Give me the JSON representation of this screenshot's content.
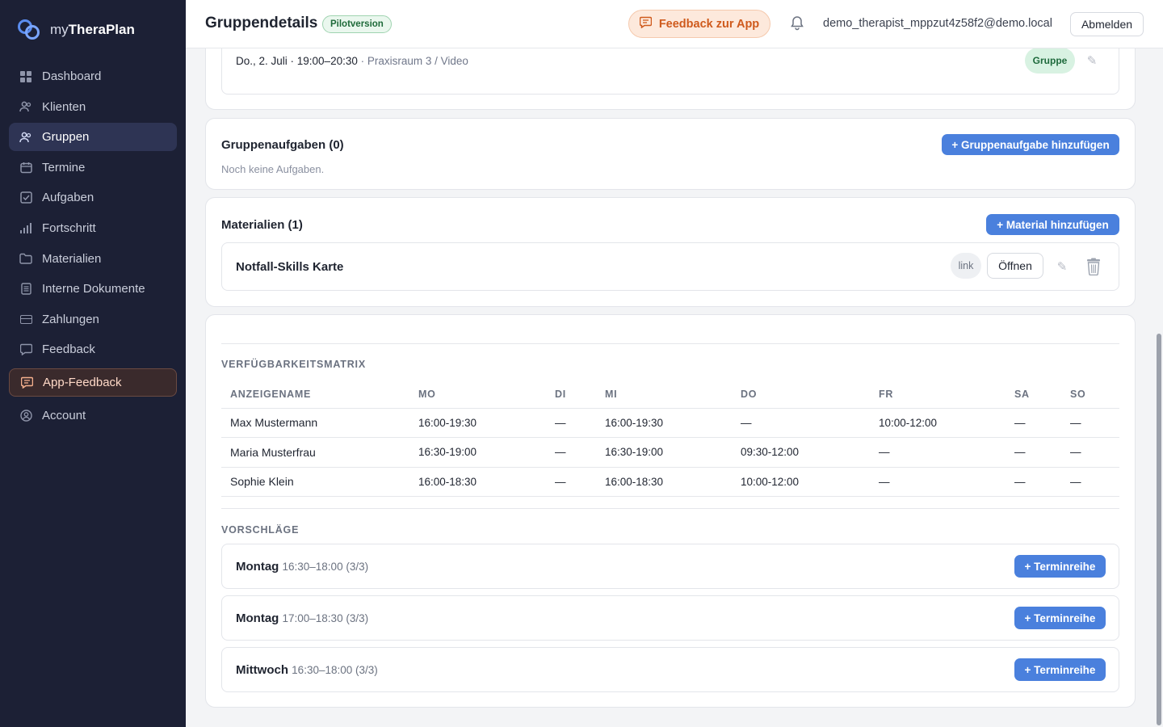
{
  "brand": {
    "prefix": "my",
    "name": "TheraPlan"
  },
  "sidebar": {
    "items": [
      {
        "label": "Dashboard",
        "icon": "grid-icon"
      },
      {
        "label": "Klienten",
        "icon": "users-icon"
      },
      {
        "label": "Gruppen",
        "icon": "group-icon"
      },
      {
        "label": "Termine",
        "icon": "calendar-icon"
      },
      {
        "label": "Aufgaben",
        "icon": "checkbox-icon"
      },
      {
        "label": "Fortschritt",
        "icon": "bar-chart-icon"
      },
      {
        "label": "Materialien",
        "icon": "folder-icon"
      },
      {
        "label": "Interne Dokumente",
        "icon": "document-icon"
      },
      {
        "label": "Zahlungen",
        "icon": "credit-card-icon"
      },
      {
        "label": "Feedback",
        "icon": "chat-bubble-icon"
      },
      {
        "label": "App-Feedback",
        "icon": "message-icon"
      },
      {
        "label": "Account",
        "icon": "user-circle-icon"
      }
    ]
  },
  "header": {
    "title": "Gruppendetails",
    "badge": "Pilotversion",
    "feedback_label": "Feedback zur App",
    "user_email": "demo_therapist_mppzut4z58f2@demo.local",
    "logout_label": "Abmelden"
  },
  "session": {
    "date_time": "Do., 2. Juli · 19:00–20:30",
    "location": "· Praxisraum 3 / Video",
    "type_label": "Gruppe"
  },
  "tasks": {
    "title": "Gruppenaufgaben (0)",
    "add_label": "+ Gruppenaufgabe hinzufügen",
    "empty_text": "Noch keine Aufgaben."
  },
  "materials": {
    "title": "Materialien (1)",
    "add_label": "+ Material hinzufügen",
    "items": [
      {
        "name": "Notfall-Skills Karte",
        "tag": "link",
        "open_label": "Öffnen"
      }
    ]
  },
  "matrix": {
    "title": "VERFÜGBARKEITSMATRIX",
    "headers": [
      "ANZEIGENAME",
      "MO",
      "DI",
      "MI",
      "DO",
      "FR",
      "SA",
      "SO"
    ],
    "rows": [
      [
        "Max Mustermann",
        "16:00-19:30",
        "—",
        "16:00-19:30",
        "—",
        "10:00-12:00",
        "—",
        "—"
      ],
      [
        "Maria Musterfrau",
        "16:30-19:00",
        "—",
        "16:30-19:00",
        "09:30-12:00",
        "—",
        "—",
        "—"
      ],
      [
        "Sophie Klein",
        "16:00-18:30",
        "—",
        "16:00-18:30",
        "10:00-12:00",
        "—",
        "—",
        "—"
      ]
    ]
  },
  "suggestions": {
    "title": "VORSCHLÄGE",
    "button_label": "+ Terminreihe",
    "items": [
      {
        "day": "Montag",
        "detail": "16:30–18:00 (3/3)"
      },
      {
        "day": "Montag",
        "detail": "17:00–18:30 (3/3)"
      },
      {
        "day": "Mittwoch",
        "detail": "16:30–18:00 (3/3)"
      }
    ]
  },
  "colors": {
    "sidebar_bg": "#1c2035",
    "accent": "#4a80dd",
    "feedback_orange": "#cf5a1c",
    "success_green": "#1e6a3c"
  }
}
